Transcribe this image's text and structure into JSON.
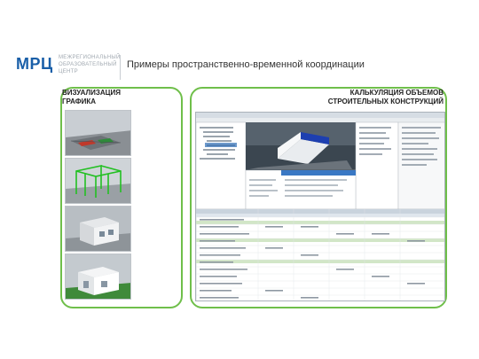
{
  "header": {
    "logo_mark": "МРЦ",
    "logo_lines": [
      "МЕЖРЕГИОНАЛЬНЫЙ",
      "ОБРАЗОВАТЕЛЬНЫЙ",
      "ЦЕНТР"
    ],
    "title": "Примеры пространственно-временной координации"
  },
  "panels": {
    "left_heading": "ВИЗУАЛИЗАЦИЯ ГРАФИКА",
    "right_heading": "КАЛЬКУЛЯЦИЯ ОБЪЕМОВ СТРОИТЕЛЬНЫХ КОНСТРУКЦИЙ"
  },
  "colors": {
    "accent": "#6fbf4a",
    "brand": "#1a5fa8"
  }
}
